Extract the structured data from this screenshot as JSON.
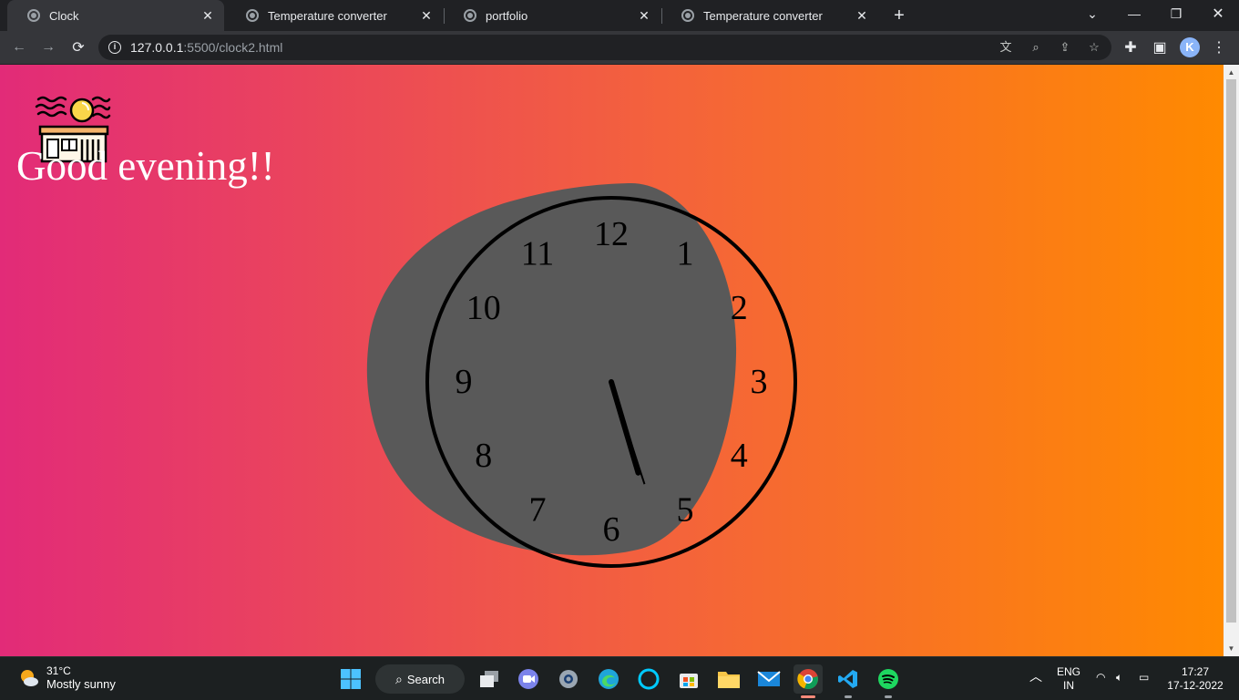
{
  "browser": {
    "tabs": [
      {
        "label": "Clock",
        "active": true
      },
      {
        "label": "Temperature converter",
        "active": false
      },
      {
        "label": "portfolio",
        "active": false
      },
      {
        "label": "Temperature converter",
        "active": false
      }
    ],
    "url_host": "127.0.0.1",
    "url_path": ":5500/clock2.html",
    "profile_initial": "K"
  },
  "page": {
    "greeting": "Good evening!!",
    "clock": {
      "numbers": [
        "12",
        "1",
        "2",
        "3",
        "4",
        "5",
        "6",
        "7",
        "8",
        "9",
        "10",
        "11"
      ],
      "hour": 5,
      "minute": 27,
      "face_color": "#595959",
      "ring_color": "#000000"
    },
    "background_gradient": [
      "#e22b78",
      "#f4633b",
      "#ff8a00"
    ]
  },
  "taskbar": {
    "weather_temp": "31°C",
    "weather_condition": "Mostly sunny",
    "search_label": "Search",
    "language_primary": "ENG",
    "language_secondary": "IN",
    "time": "17:27",
    "date": "17-12-2022"
  }
}
